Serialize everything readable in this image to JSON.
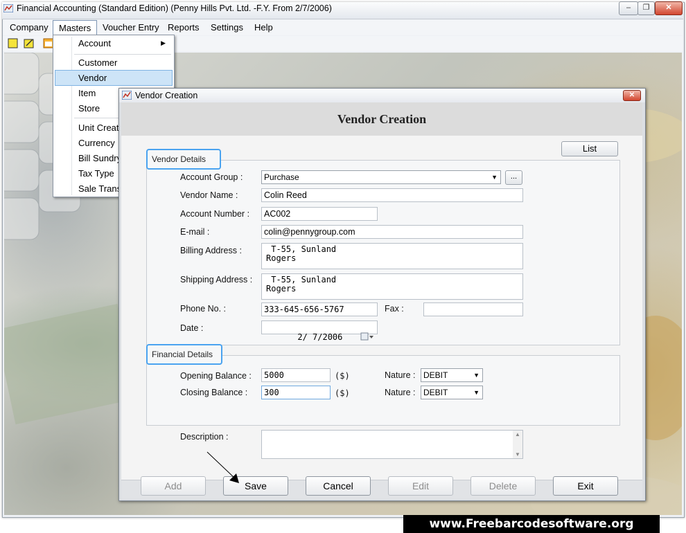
{
  "window": {
    "title": "Financial Accounting (Standard Edition) (Penny Hills Pvt. Ltd. -F.Y. From 2/7/2006)"
  },
  "menubar": [
    "Company",
    "Masters",
    "Voucher Entry",
    "Reports",
    "Settings",
    "Help"
  ],
  "masters_menu": {
    "items": [
      "Account",
      "Customer",
      "Vendor",
      "Item",
      "Store",
      "Unit Creati",
      "Currency",
      "Bill Sundry",
      "Tax Type",
      "Sale Trans"
    ],
    "highlighted": "Vendor"
  },
  "dialog": {
    "window_title": "Vendor Creation",
    "heading": "Vendor Creation",
    "list_button": "List",
    "vendor_details_label": "Vendor Details",
    "financial_details_label": "Financial Details",
    "fields": {
      "account_group_label": "Account Group :",
      "account_group_value": "Purchase",
      "browse_button": "...",
      "vendor_name_label": "Vendor Name :",
      "vendor_name_value": "Colin Reed",
      "account_number_label": "Account Number :",
      "account_number_value": "AC002",
      "email_label": "E-mail :",
      "email_value": "colin@pennygroup.com",
      "billing_address_label": "Billing Address :",
      "billing_address_value": " T-55, Sunland\nRogers",
      "shipping_address_label": "Shipping Address :",
      "shipping_address_value": " T-55, Sunland\nRogers",
      "phone_label": "Phone No. :",
      "phone_value": "333-645-656-5767",
      "fax_label": "Fax :",
      "fax_value": "",
      "date_label": "Date :",
      "date_value": "2/ 7/2006",
      "opening_balance_label": "Opening Balance :",
      "opening_balance_value": "5000",
      "closing_balance_label": "Closing Balance :",
      "closing_balance_value": "300",
      "currency_unit": "($)",
      "nature_label": "Nature :",
      "opening_nature": "DEBIT",
      "closing_nature": "DEBIT",
      "description_label": "Description :",
      "description_value": ""
    },
    "buttons": [
      "Add",
      "Save",
      "Cancel",
      "Edit",
      "Delete",
      "Exit"
    ]
  },
  "watermark": "www.Freebarcodesoftware.org",
  "colors": {
    "accent_blue": "#4aa3f0",
    "menu_highlight": "#cde4f7",
    "close_red": "#d2462f"
  }
}
